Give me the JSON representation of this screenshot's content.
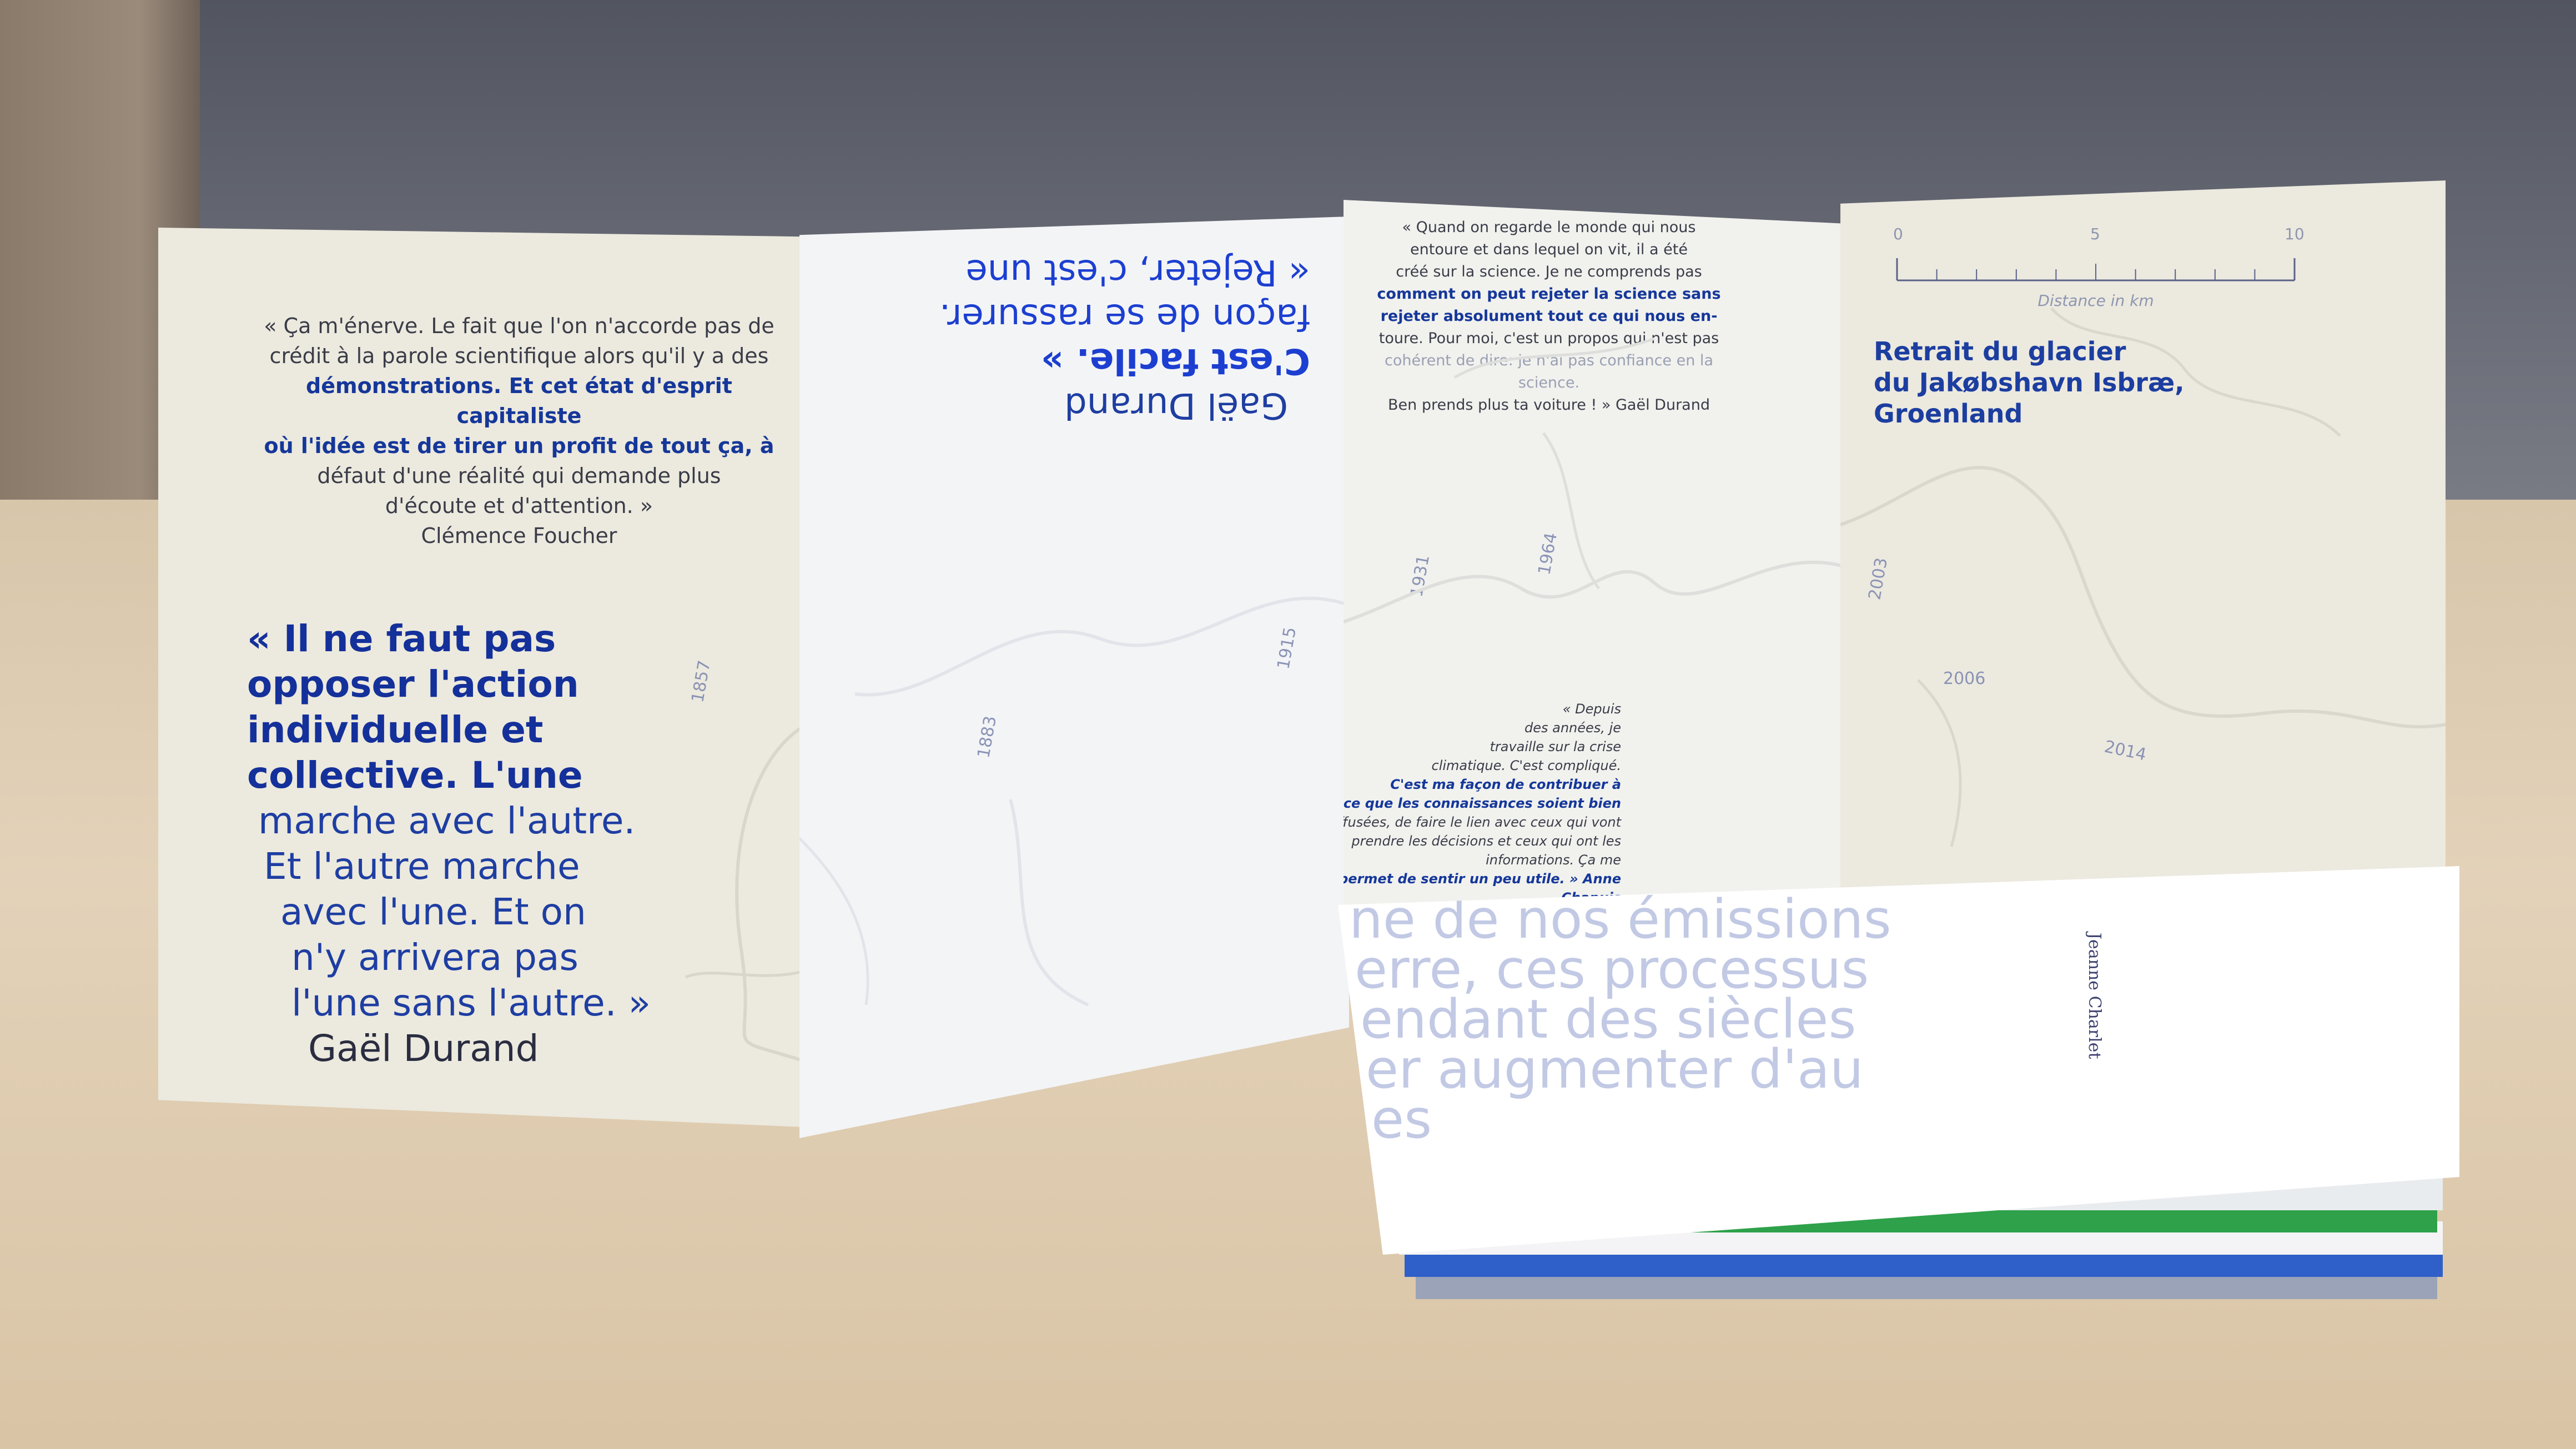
{
  "panel1": {
    "quote_small_lines": [
      "« Ça m'énerve. Le fait que l'on n'accorde pas de",
      "crédit à la parole scientifique alors qu'il y a des",
      "démonstrations. Et cet état d'esprit capitaliste",
      "où l'idée est de tirer un profit de tout ça, à",
      "défaut d'une réalité qui demande plus",
      "d'écoute et d'attention. »"
    ],
    "quote_small_author": "Clémence Foucher",
    "quote_big_lines": [
      "« Il ne faut pas",
      "opposer l'action",
      "individuelle et",
      "collective. L'une",
      "marche avec l'autre.",
      "Et l'autre marche",
      "avec l'une. Et on",
      "n'y arrivera pas",
      "l'une sans l'autre. »"
    ],
    "quote_big_author": "Gaël Durand",
    "year": "1857"
  },
  "panel2": {
    "upside_lines": [
      "« Rejeter, c'est une",
      "façon de se rassurer.",
      "C'est facile. »"
    ],
    "upside_author": "Gaël Durand",
    "years": [
      "1883",
      "1915"
    ]
  },
  "panel3": {
    "quote_top_lines": [
      "« Quand on regarde le monde qui nous",
      "entoure et dans lequel on vit, il a été",
      "créé sur la science. Je ne comprends pas",
      "comment on peut rejeter la science sans",
      "rejeter absolument tout ce qui nous en-",
      "toure. Pour moi, c'est un propos qui n'est pas",
      "cohérent de dire: je n'ai pas confiance en la science.",
      "Ben prends plus ta voiture ! » Gaël Durand"
    ],
    "quote_bottom_lines": [
      "« Depuis",
      "des années, je",
      "travaille sur la crise",
      "climatique. C'est compliqué.",
      "C'est ma façon de contribuer à",
      "ce que les connaissances soient bien",
      "diffusées, de faire le lien avec ceux qui vont",
      "prendre les décisions et ceux qui ont les informations. Ça me",
      "permet de sentir un peu utile. » Anne Chapuis"
    ],
    "years": [
      "1931",
      "1964"
    ]
  },
  "panel4": {
    "scale_ticks": [
      "0",
      "5",
      "10"
    ],
    "scale_label": "Distance in km",
    "title_lines": [
      "Retrait du glacier",
      "du Jakøbshavn Isbræ,",
      "Groenland"
    ],
    "years": [
      "2003",
      "2006",
      "2014"
    ]
  },
  "booklet": {
    "text_lines": [
      "ne de nos émissions",
      "erre, ces processus",
      "endant des siècles",
      "er augmenter d'au",
      "es"
    ],
    "vertical_author": "Jeanne Charlet"
  }
}
